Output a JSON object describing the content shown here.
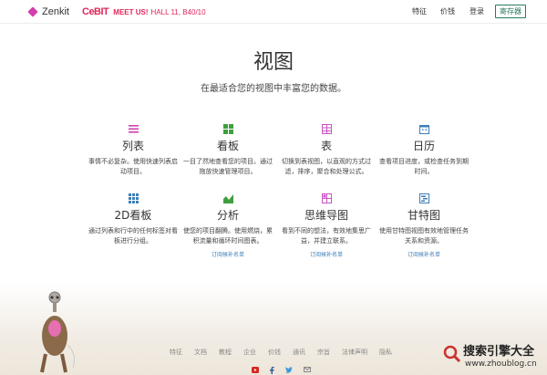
{
  "header": {
    "brand": "Zenkit",
    "cebit_logo": "CeBIT",
    "cebit_meet": "MEET US!",
    "cebit_hall": "HALL 11, B40/10",
    "nav": [
      "特征",
      "价钱",
      "登录"
    ],
    "register": "寄存器"
  },
  "hero": {
    "title": "视图",
    "subtitle": "在最适合您的视图中丰富您的数据。"
  },
  "features": [
    {
      "name": "列表",
      "desc1": "事情不必复杂。使用快速列表启",
      "desc2": "动项目。",
      "icon": "list-icon",
      "color": "#d33fae",
      "link": ""
    },
    {
      "name": "看板",
      "desc1": "一目了然地查看您的项目。通过",
      "desc2": "拖放快速管理项目。",
      "icon": "kanban-icon",
      "color": "#3f9e3f",
      "link": ""
    },
    {
      "name": "表",
      "desc1": "切换到表视图，以直观的方式过",
      "desc2": "滤，排序，聚合和处理公式。",
      "icon": "table-icon",
      "color": "#c856c4",
      "link": ""
    },
    {
      "name": "日历",
      "desc1": "查看项目进度，或检查任务到期",
      "desc2": "时间。",
      "icon": "calendar-icon",
      "color": "#3c7fb8",
      "link": ""
    },
    {
      "name": "2D看板",
      "desc1": "通过列表和行中的任何标签对看",
      "desc2": "板进行分组。",
      "icon": "grid-2d-icon",
      "color": "#3c7fb8",
      "link": ""
    },
    {
      "name": "分析",
      "desc1": "使您的项目翻腾。使用燃烧，累",
      "desc2": "积流量和循环时间图表。",
      "icon": "chart-icon",
      "color": "#3f9e3f",
      "link": "订阅候补名单"
    },
    {
      "name": "思维导图",
      "desc1": "看到不同的想法，有效地集思广",
      "desc2": "益，并建立联系。",
      "icon": "mindmap-icon",
      "color": "#c856c4",
      "link": "订阅候补名单"
    },
    {
      "name": "甘特图",
      "desc1": "使用甘特图视图有效地管理任务",
      "desc2": "关系和资源。",
      "icon": "gantt-icon",
      "color": "#3c7fb8",
      "link": "订阅候补名单"
    }
  ],
  "footer": {
    "links": [
      "特征",
      "文档",
      "教程",
      "企业",
      "价钱",
      "通讯",
      "宗旨",
      "法律声明",
      "隐私"
    ],
    "social": [
      "youtube-icon",
      "facebook-icon",
      "twitter-icon",
      "email-icon"
    ]
  },
  "watermark": {
    "title": "搜索引擎大全",
    "url": "www.zhoublog.cn"
  }
}
